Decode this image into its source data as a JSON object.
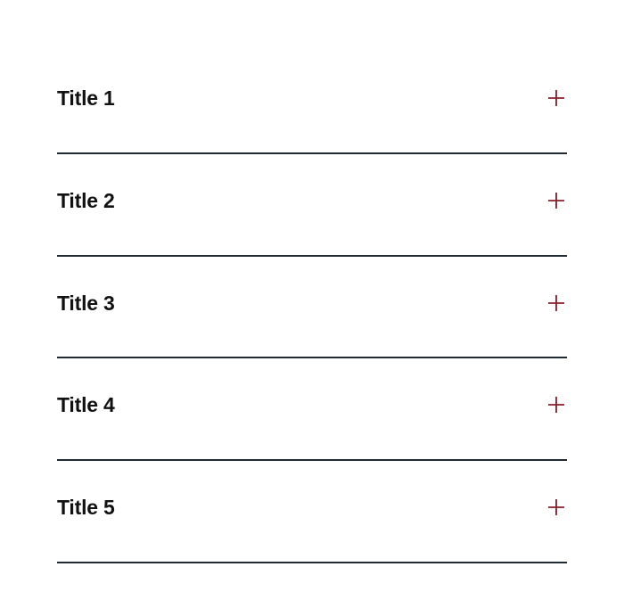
{
  "accordion": {
    "accent_color": "#8b1f2a",
    "divider_color": "#1f2a33",
    "items": [
      {
        "title": "Title 1",
        "icon": "plus-icon",
        "expanded": false
      },
      {
        "title": "Title 2",
        "icon": "plus-icon",
        "expanded": false
      },
      {
        "title": "Title 3",
        "icon": "plus-icon",
        "expanded": false
      },
      {
        "title": "Title 4",
        "icon": "plus-icon",
        "expanded": false
      },
      {
        "title": "Title 5",
        "icon": "plus-icon",
        "expanded": false
      }
    ]
  }
}
